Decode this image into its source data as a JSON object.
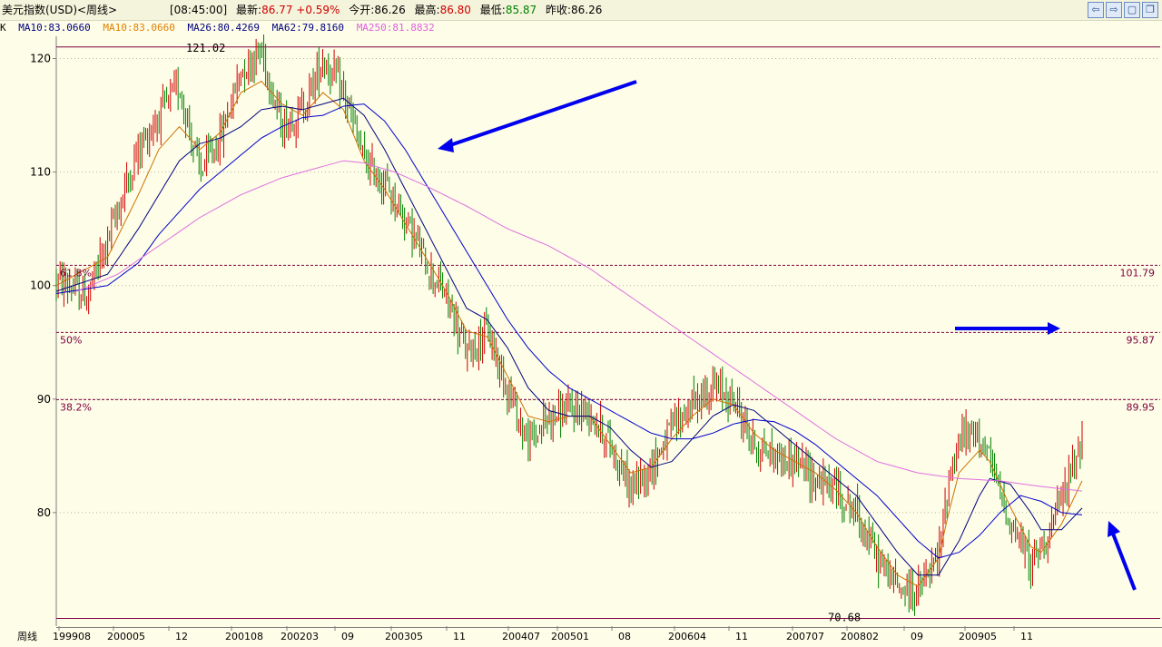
{
  "titlebar": {
    "name": "美元指数(USD)<周线>",
    "time": "[08:45:00]",
    "latest_label": "最新:",
    "latest": "86.77",
    "change": "+0.59%",
    "open_label": "今开:",
    "open": "86.26",
    "high_label": "最高:",
    "high": "86.80",
    "low_label": "最低:",
    "low": "85.87",
    "prev_label": "昨收:",
    "prev": "86.26",
    "buttons": [
      "⇦",
      "⇨",
      "▢",
      "❐"
    ]
  },
  "ma_legend": {
    "k": "K",
    "ma10a": "MA10:83.0660",
    "ma10b": "MA10:83.0660",
    "ma26": "MA26:80.4269",
    "ma62": "MA62:79.8160",
    "ma250": "MA250:81.8832",
    "colors": {
      "ma10a": "#000080",
      "ma10b": "#e08000",
      "ma26": "#000080",
      "ma62": "#000080",
      "ma250": "#e060e0"
    }
  },
  "chart_data": {
    "type": "candlestick",
    "ylim": [
      70,
      121.8
    ],
    "y_ticks": [
      80,
      90,
      100,
      110,
      120
    ],
    "x_tick_labels": [
      "周线",
      "199908",
      "200005",
      "12",
      "200108",
      "200203",
      "09",
      "200305",
      "11",
      "200407",
      "200501",
      "08",
      "200604",
      "11",
      "200707",
      "200802",
      "09",
      "200905",
      "11"
    ],
    "peak_label": "121.02",
    "peak_value": 121.02,
    "trough_label": "70.68",
    "trough_value": 70.68,
    "fib_levels": [
      {
        "left_label": "61.8%",
        "value": 101.79,
        "right_label": "101.79"
      },
      {
        "left_label": "50%",
        "value": 95.87,
        "right_label": "95.87"
      },
      {
        "left_label": "38.2%",
        "value": 89.95,
        "right_label": "89.95"
      }
    ],
    "price_path": [
      [
        0,
        100.5
      ],
      [
        0.03,
        99
      ],
      [
        0.05,
        104
      ],
      [
        0.08,
        112
      ],
      [
        0.1,
        115
      ],
      [
        0.12,
        117.5
      ],
      [
        0.14,
        110
      ],
      [
        0.16,
        113
      ],
      [
        0.18,
        119
      ],
      [
        0.2,
        120.8
      ],
      [
        0.22,
        114
      ],
      [
        0.24,
        115.5
      ],
      [
        0.26,
        120
      ],
      [
        0.28,
        117
      ],
      [
        0.3,
        111
      ],
      [
        0.32,
        109
      ],
      [
        0.34,
        106
      ],
      [
        0.36,
        102
      ],
      [
        0.38,
        99
      ],
      [
        0.4,
        94
      ],
      [
        0.42,
        96
      ],
      [
        0.44,
        91
      ],
      [
        0.46,
        86
      ],
      [
        0.48,
        88.5
      ],
      [
        0.5,
        89
      ],
      [
        0.52,
        89
      ],
      [
        0.54,
        86
      ],
      [
        0.56,
        82
      ],
      [
        0.58,
        84
      ],
      [
        0.6,
        87.5
      ],
      [
        0.62,
        89.5
      ],
      [
        0.64,
        91
      ],
      [
        0.66,
        90
      ],
      [
        0.68,
        86
      ],
      [
        0.7,
        85
      ],
      [
        0.72,
        84.5
      ],
      [
        0.74,
        83
      ],
      [
        0.76,
        82
      ],
      [
        0.78,
        80
      ],
      [
        0.8,
        76
      ],
      [
        0.82,
        73.5
      ],
      [
        0.84,
        73
      ],
      [
        0.86,
        76
      ],
      [
        0.87,
        83
      ],
      [
        0.88,
        86.5
      ],
      [
        0.9,
        87
      ],
      [
        0.91,
        84.5
      ],
      [
        0.93,
        79
      ],
      [
        0.95,
        75.5
      ],
      [
        0.96,
        77
      ],
      [
        0.98,
        81
      ],
      [
        0.99,
        84
      ],
      [
        1.0,
        86.8
      ]
    ],
    "ma_series": {
      "ma10": [
        [
          0,
          100
        ],
        [
          0.05,
          102.5
        ],
        [
          0.08,
          108
        ],
        [
          0.1,
          112
        ],
        [
          0.12,
          114
        ],
        [
          0.14,
          112
        ],
        [
          0.16,
          113.5
        ],
        [
          0.18,
          117
        ],
        [
          0.2,
          118
        ],
        [
          0.22,
          116
        ],
        [
          0.24,
          115
        ],
        [
          0.26,
          117
        ],
        [
          0.28,
          115.5
        ],
        [
          0.3,
          111
        ],
        [
          0.32,
          108.5
        ],
        [
          0.34,
          105.5
        ],
        [
          0.36,
          102.5
        ],
        [
          0.38,
          99.5
        ],
        [
          0.4,
          96
        ],
        [
          0.42,
          95.5
        ],
        [
          0.44,
          92
        ],
        [
          0.46,
          88.5
        ],
        [
          0.48,
          88
        ],
        [
          0.5,
          88.5
        ],
        [
          0.52,
          88.5
        ],
        [
          0.54,
          86
        ],
        [
          0.56,
          83.5
        ],
        [
          0.58,
          84
        ],
        [
          0.6,
          86.5
        ],
        [
          0.62,
          88.5
        ],
        [
          0.64,
          90
        ],
        [
          0.66,
          89.5
        ],
        [
          0.68,
          87
        ],
        [
          0.7,
          85.5
        ],
        [
          0.72,
          84.5
        ],
        [
          0.74,
          83.5
        ],
        [
          0.76,
          82
        ],
        [
          0.78,
          80
        ],
        [
          0.8,
          77
        ],
        [
          0.82,
          74.5
        ],
        [
          0.84,
          73.5
        ],
        [
          0.86,
          76
        ],
        [
          0.87,
          80
        ],
        [
          0.88,
          83.5
        ],
        [
          0.9,
          85.5
        ],
        [
          0.91,
          84.5
        ],
        [
          0.93,
          80.5
        ],
        [
          0.95,
          77
        ],
        [
          0.96,
          76.5
        ],
        [
          0.98,
          79
        ],
        [
          1.0,
          82.8
        ]
      ],
      "ma26": [
        [
          0,
          99.5
        ],
        [
          0.05,
          101
        ],
        [
          0.08,
          105
        ],
        [
          0.1,
          108
        ],
        [
          0.12,
          111
        ],
        [
          0.14,
          112.5
        ],
        [
          0.16,
          113
        ],
        [
          0.18,
          114
        ],
        [
          0.2,
          115.5
        ],
        [
          0.22,
          115.8
        ],
        [
          0.24,
          115.5
        ],
        [
          0.26,
          116
        ],
        [
          0.28,
          116.5
        ],
        [
          0.3,
          115
        ],
        [
          0.32,
          112
        ],
        [
          0.34,
          108.5
        ],
        [
          0.36,
          105
        ],
        [
          0.38,
          101.5
        ],
        [
          0.4,
          98
        ],
        [
          0.42,
          97
        ],
        [
          0.44,
          94.5
        ],
        [
          0.46,
          91
        ],
        [
          0.48,
          89
        ],
        [
          0.5,
          88.5
        ],
        [
          0.52,
          88.5
        ],
        [
          0.54,
          87.5
        ],
        [
          0.56,
          85.5
        ],
        [
          0.58,
          84
        ],
        [
          0.6,
          84.5
        ],
        [
          0.62,
          86.5
        ],
        [
          0.64,
          88.5
        ],
        [
          0.66,
          89.5
        ],
        [
          0.68,
          89
        ],
        [
          0.7,
          87.5
        ],
        [
          0.72,
          86
        ],
        [
          0.74,
          84.5
        ],
        [
          0.76,
          83
        ],
        [
          0.78,
          81.5
        ],
        [
          0.8,
          79
        ],
        [
          0.82,
          76.5
        ],
        [
          0.84,
          74.5
        ],
        [
          0.86,
          74.5
        ],
        [
          0.88,
          77.5
        ],
        [
          0.9,
          81.5
        ],
        [
          0.91,
          83
        ],
        [
          0.93,
          82.5
        ],
        [
          0.95,
          80
        ],
        [
          0.96,
          78.5
        ],
        [
          0.98,
          78.5
        ],
        [
          1.0,
          80.4
        ]
      ],
      "ma62": [
        [
          0,
          99.3
        ],
        [
          0.05,
          100
        ],
        [
          0.08,
          102
        ],
        [
          0.1,
          104.5
        ],
        [
          0.12,
          106.5
        ],
        [
          0.14,
          108.5
        ],
        [
          0.16,
          110
        ],
        [
          0.18,
          111.5
        ],
        [
          0.2,
          113
        ],
        [
          0.22,
          114
        ],
        [
          0.24,
          114.8
        ],
        [
          0.26,
          115
        ],
        [
          0.28,
          115.8
        ],
        [
          0.3,
          116
        ],
        [
          0.32,
          114.5
        ],
        [
          0.34,
          112
        ],
        [
          0.36,
          109
        ],
        [
          0.38,
          106
        ],
        [
          0.4,
          103
        ],
        [
          0.42,
          100
        ],
        [
          0.44,
          97
        ],
        [
          0.46,
          94.5
        ],
        [
          0.48,
          92.5
        ],
        [
          0.5,
          91
        ],
        [
          0.52,
          90
        ],
        [
          0.54,
          89
        ],
        [
          0.56,
          88
        ],
        [
          0.58,
          87
        ],
        [
          0.6,
          86.5
        ],
        [
          0.62,
          86.5
        ],
        [
          0.64,
          87
        ],
        [
          0.66,
          87.8
        ],
        [
          0.68,
          88.2
        ],
        [
          0.7,
          88
        ],
        [
          0.72,
          87.2
        ],
        [
          0.74,
          86
        ],
        [
          0.76,
          84.5
        ],
        [
          0.78,
          83
        ],
        [
          0.8,
          81.5
        ],
        [
          0.82,
          79.5
        ],
        [
          0.84,
          77.5
        ],
        [
          0.86,
          76
        ],
        [
          0.88,
          76.5
        ],
        [
          0.9,
          78
        ],
        [
          0.92,
          80
        ],
        [
          0.94,
          81.5
        ],
        [
          0.96,
          81
        ],
        [
          0.98,
          80
        ],
        [
          1.0,
          79.8
        ]
      ],
      "ma250": [
        [
          0.02,
          99.5
        ],
        [
          0.06,
          101
        ],
        [
          0.1,
          103.5
        ],
        [
          0.14,
          106
        ],
        [
          0.18,
          108
        ],
        [
          0.22,
          109.5
        ],
        [
          0.26,
          110.5
        ],
        [
          0.28,
          111
        ],
        [
          0.3,
          110.8
        ],
        [
          0.33,
          110
        ],
        [
          0.36,
          108.8
        ],
        [
          0.4,
          107
        ],
        [
          0.44,
          105
        ],
        [
          0.48,
          103.5
        ],
        [
          0.52,
          101.5
        ],
        [
          0.56,
          99
        ],
        [
          0.6,
          96.5
        ],
        [
          0.64,
          94
        ],
        [
          0.68,
          91.5
        ],
        [
          0.72,
          89
        ],
        [
          0.76,
          86.5
        ],
        [
          0.8,
          84.5
        ],
        [
          0.84,
          83.5
        ],
        [
          0.88,
          83
        ],
        [
          0.92,
          82.8
        ],
        [
          0.96,
          82.3
        ],
        [
          1.0,
          81.9
        ]
      ]
    }
  }
}
